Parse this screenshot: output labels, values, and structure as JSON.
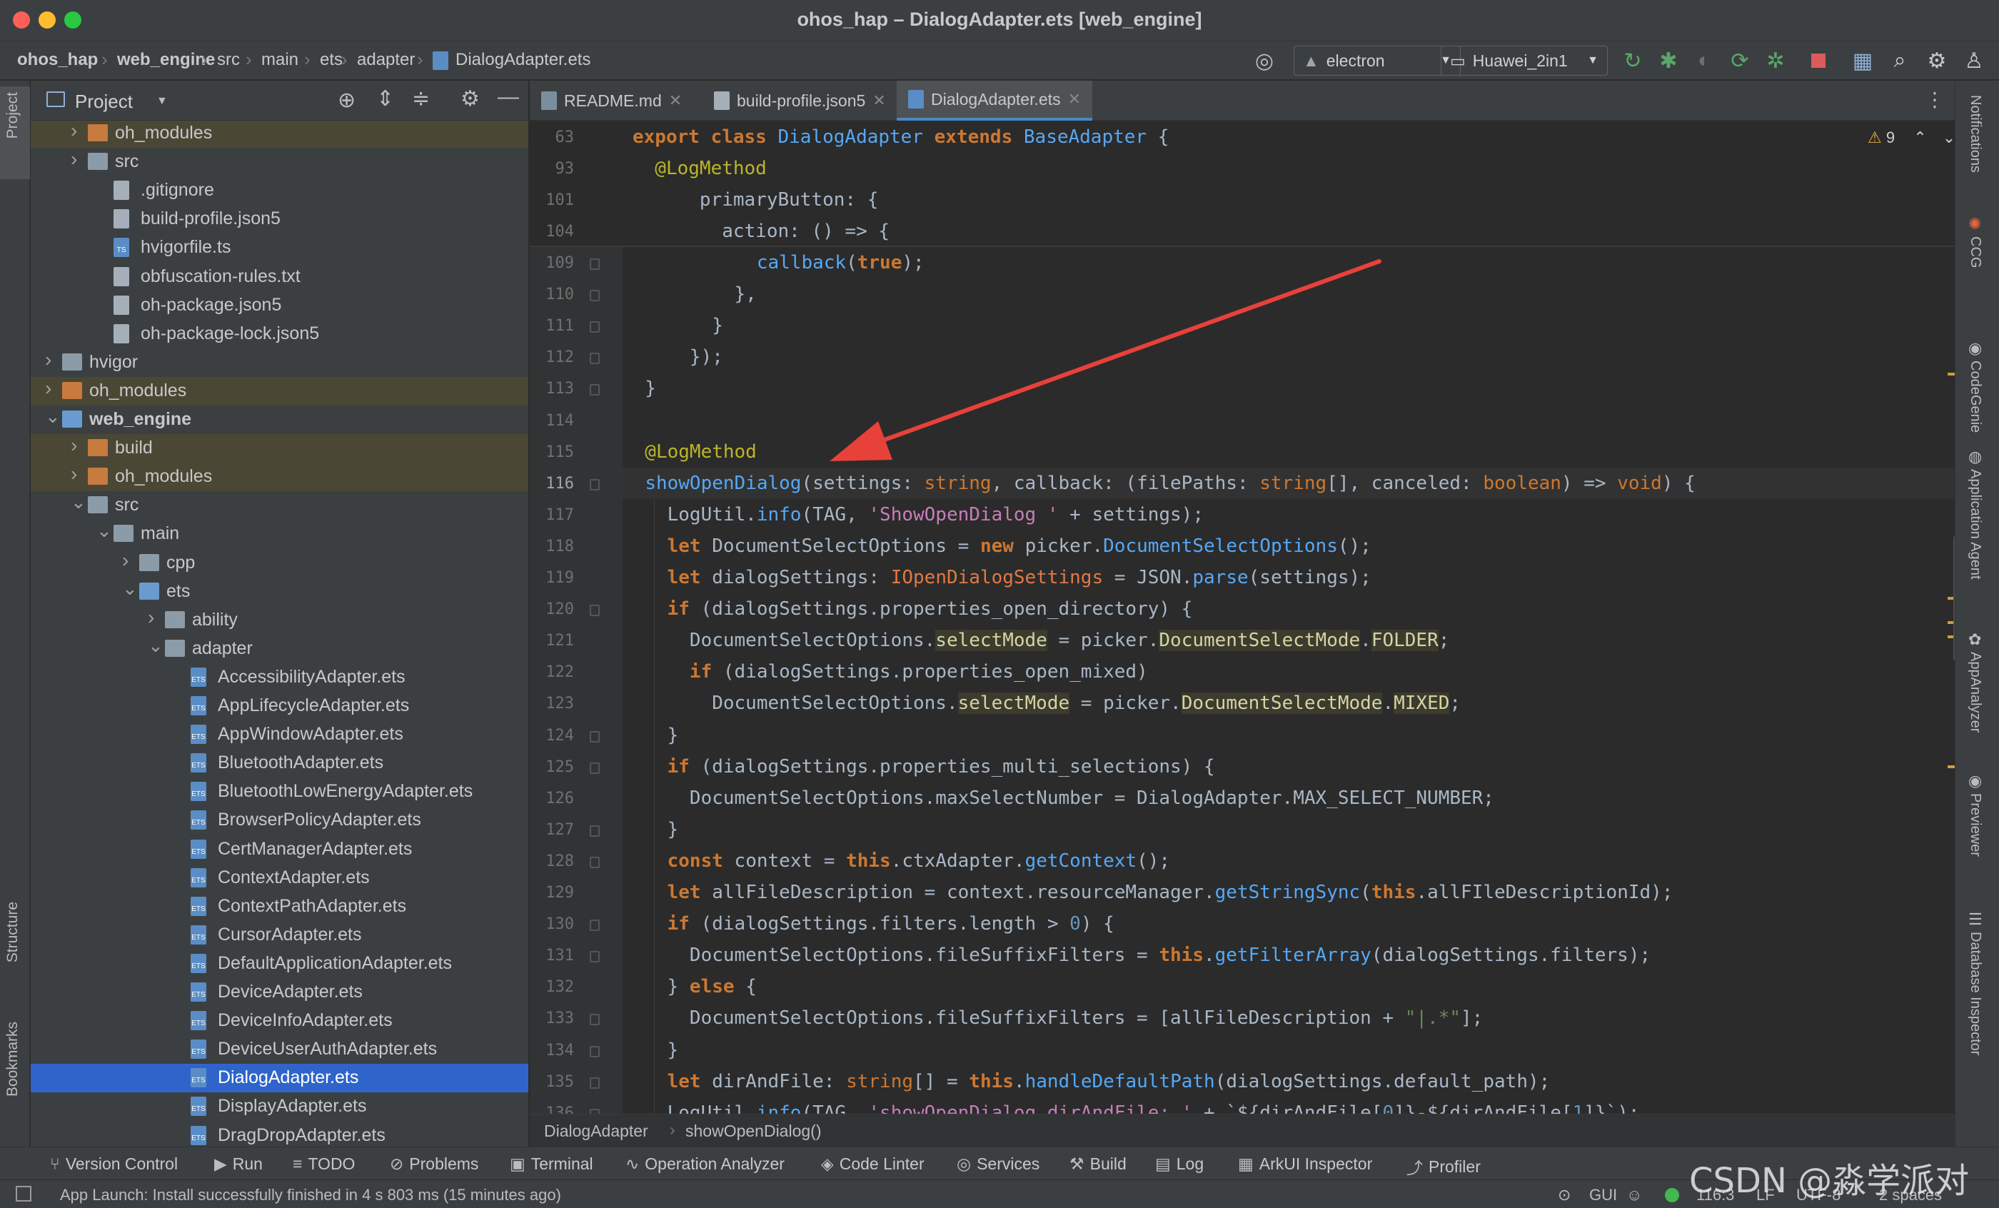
{
  "window": {
    "title": "ohos_hap – DialogAdapter.ets [web_engine]"
  },
  "breadcrumb": [
    "ohos_hap",
    "web_engine",
    "src",
    "main",
    "ets",
    "adapter",
    "DialogAdapter.ets"
  ],
  "toolbar": {
    "config_label": "electron",
    "device_label": "Huawei_2in1"
  },
  "project_panel": {
    "title": "Project"
  },
  "left_tabs": [
    "Project",
    "Structure",
    "Bookmarks"
  ],
  "tree": [
    {
      "label": "oh_modules",
      "depth": 2,
      "icon": "folder-orange",
      "arrow": "right",
      "hl": true
    },
    {
      "label": "src",
      "depth": 2,
      "icon": "folder",
      "arrow": "right"
    },
    {
      "label": ".gitignore",
      "depth": 3,
      "icon": "file"
    },
    {
      "label": "build-profile.json5",
      "depth": 3,
      "icon": "file"
    },
    {
      "label": "hvigorfile.ts",
      "depth": 3,
      "icon": "ts-file"
    },
    {
      "label": "obfuscation-rules.txt",
      "depth": 3,
      "icon": "file"
    },
    {
      "label": "oh-package.json5",
      "depth": 3,
      "icon": "file"
    },
    {
      "label": "oh-package-lock.json5",
      "depth": 3,
      "icon": "file"
    },
    {
      "label": "hvigor",
      "depth": 1,
      "icon": "folder",
      "arrow": "right"
    },
    {
      "label": "oh_modules",
      "depth": 1,
      "icon": "folder-orange",
      "arrow": "right",
      "hl": true
    },
    {
      "label": "web_engine",
      "depth": 1,
      "icon": "folder-blue",
      "arrow": "down",
      "bold": true
    },
    {
      "label": "build",
      "depth": 2,
      "icon": "folder-orange",
      "arrow": "right",
      "hl": true
    },
    {
      "label": "oh_modules",
      "depth": 2,
      "icon": "folder-orange",
      "arrow": "right",
      "hl": true
    },
    {
      "label": "src",
      "depth": 2,
      "icon": "folder",
      "arrow": "down"
    },
    {
      "label": "main",
      "depth": 3,
      "icon": "folder",
      "arrow": "down"
    },
    {
      "label": "cpp",
      "depth": 4,
      "icon": "folder",
      "arrow": "right"
    },
    {
      "label": "ets",
      "depth": 4,
      "icon": "folder-blue",
      "arrow": "down"
    },
    {
      "label": "ability",
      "depth": 5,
      "icon": "folder",
      "arrow": "right"
    },
    {
      "label": "adapter",
      "depth": 5,
      "icon": "folder",
      "arrow": "down"
    },
    {
      "label": "AccessibilityAdapter.ets",
      "depth": 6,
      "icon": "ets-file"
    },
    {
      "label": "AppLifecycleAdapter.ets",
      "depth": 6,
      "icon": "ets-file"
    },
    {
      "label": "AppWindowAdapter.ets",
      "depth": 6,
      "icon": "ets-file"
    },
    {
      "label": "BluetoothAdapter.ets",
      "depth": 6,
      "icon": "ets-file"
    },
    {
      "label": "BluetoothLowEnergyAdapter.ets",
      "depth": 6,
      "icon": "ets-file"
    },
    {
      "label": "BrowserPolicyAdapter.ets",
      "depth": 6,
      "icon": "ets-file"
    },
    {
      "label": "CertManagerAdapter.ets",
      "depth": 6,
      "icon": "ets-file"
    },
    {
      "label": "ContextAdapter.ets",
      "depth": 6,
      "icon": "ets-file"
    },
    {
      "label": "ContextPathAdapter.ets",
      "depth": 6,
      "icon": "ets-file"
    },
    {
      "label": "CursorAdapter.ets",
      "depth": 6,
      "icon": "ets-file"
    },
    {
      "label": "DefaultApplicationAdapter.ets",
      "depth": 6,
      "icon": "ets-file"
    },
    {
      "label": "DeviceAdapter.ets",
      "depth": 6,
      "icon": "ets-file"
    },
    {
      "label": "DeviceInfoAdapter.ets",
      "depth": 6,
      "icon": "ets-file"
    },
    {
      "label": "DeviceUserAuthAdapter.ets",
      "depth": 6,
      "icon": "ets-file"
    },
    {
      "label": "DialogAdapter.ets",
      "depth": 6,
      "icon": "ets-file",
      "selected": true
    },
    {
      "label": "DisplayAdapter.ets",
      "depth": 6,
      "icon": "ets-file"
    },
    {
      "label": "DragDropAdapter.ets",
      "depth": 6,
      "icon": "ets-file"
    }
  ],
  "tabs": [
    {
      "label": "README.md",
      "active": false
    },
    {
      "label": "build-profile.json5",
      "active": false
    },
    {
      "label": "DialogAdapter.ets",
      "active": true
    }
  ],
  "warnings": {
    "count": "9"
  },
  "sticky_lines": [
    {
      "num": "63",
      "parts": [
        [
          "k",
          "export class "
        ],
        [
          "cls",
          "DialogAdapter "
        ],
        [
          "k",
          "extends "
        ],
        [
          "cls",
          "BaseAdapter "
        ],
        [
          "",
          "{"
        ]
      ]
    },
    {
      "num": "93",
      "parts": [
        [
          "a",
          "  @LogMethod"
        ]
      ]
    },
    {
      "num": "101",
      "parts": [
        [
          "",
          "      primaryButton: {"
        ]
      ]
    },
    {
      "num": "104",
      "parts": [
        [
          "",
          "        action: () => {"
        ]
      ]
    }
  ],
  "code_lines": [
    {
      "num": "109",
      "parts": [
        [
          "",
          "            "
        ],
        [
          "f",
          "callback"
        ],
        [
          "",
          "("
        ],
        [
          "k",
          "true"
        ],
        [
          "",
          ");"
        ]
      ]
    },
    {
      "num": "110",
      "parts": [
        [
          "",
          "          },"
        ]
      ]
    },
    {
      "num": "111",
      "parts": [
        [
          "",
          "        }"
        ]
      ]
    },
    {
      "num": "112",
      "parts": [
        [
          "",
          "      });"
        ]
      ]
    },
    {
      "num": "113",
      "parts": [
        [
          "",
          "  }"
        ]
      ]
    },
    {
      "num": "114",
      "parts": [
        [
          "",
          ""
        ]
      ]
    },
    {
      "num": "115",
      "parts": [
        [
          "a",
          "  @LogMethod"
        ]
      ]
    },
    {
      "num": "116",
      "cur": true,
      "parts": [
        [
          "",
          "  "
        ],
        [
          "f",
          "showOpenDialog"
        ],
        [
          "",
          "(settings: "
        ],
        [
          "kt",
          "string"
        ],
        [
          "",
          ", callback: (filePaths: "
        ],
        [
          "kt",
          "string"
        ],
        [
          "",
          "[], canceled: "
        ],
        [
          "kt",
          "boolean"
        ],
        [
          "",
          ") => "
        ],
        [
          "kt",
          "void"
        ],
        [
          "",
          ") {"
        ]
      ]
    },
    {
      "num": "117",
      "parts": [
        [
          "",
          "    LogUtil."
        ],
        [
          "f",
          "info"
        ],
        [
          "",
          "(TAG, "
        ],
        [
          "s2",
          "'ShowOpenDialog '"
        ],
        [
          "",
          " + settings);"
        ]
      ]
    },
    {
      "num": "118",
      "parts": [
        [
          "",
          "    "
        ],
        [
          "k",
          "let "
        ],
        [
          "",
          "DocumentSelectOptions = "
        ],
        [
          "k",
          "new "
        ],
        [
          "",
          "picker."
        ],
        [
          "f",
          "DocumentSelectOptions"
        ],
        [
          "",
          "();"
        ]
      ]
    },
    {
      "num": "119",
      "parts": [
        [
          "",
          "    "
        ],
        [
          "k",
          "let "
        ],
        [
          "",
          "dialogSettings: "
        ],
        [
          "t",
          "IOpenDialogSettings"
        ],
        [
          "",
          " = JSON."
        ],
        [
          "f",
          "parse"
        ],
        [
          "",
          "(settings);"
        ]
      ]
    },
    {
      "num": "120",
      "parts": [
        [
          "",
          "    "
        ],
        [
          "k",
          "if "
        ],
        [
          "",
          "(dialogSettings.properties_open_directory) {"
        ]
      ]
    },
    {
      "num": "121",
      "parts": [
        [
          "",
          "      DocumentSelectOptions."
        ],
        [
          "hlw",
          "selectMode"
        ],
        [
          "",
          " = picker."
        ],
        [
          "hlw",
          "DocumentSelectMode"
        ],
        [
          "",
          "."
        ],
        [
          "hlw",
          "FOLDER"
        ],
        [
          "",
          ";"
        ]
      ]
    },
    {
      "num": "122",
      "parts": [
        [
          "",
          "      "
        ],
        [
          "k",
          "if "
        ],
        [
          "",
          "(dialogSettings.properties_open_mixed)"
        ]
      ]
    },
    {
      "num": "123",
      "parts": [
        [
          "",
          "        DocumentSelectOptions."
        ],
        [
          "hlw",
          "selectMode"
        ],
        [
          "",
          " = picker."
        ],
        [
          "hlw",
          "DocumentSelectMode"
        ],
        [
          "",
          "."
        ],
        [
          "hlw",
          "MIXED"
        ],
        [
          "",
          ";"
        ]
      ]
    },
    {
      "num": "124",
      "parts": [
        [
          "",
          "    }"
        ]
      ]
    },
    {
      "num": "125",
      "parts": [
        [
          "",
          "    "
        ],
        [
          "k",
          "if "
        ],
        [
          "",
          "(dialogSettings.properties_multi_selections) {"
        ]
      ]
    },
    {
      "num": "126",
      "parts": [
        [
          "",
          "      DocumentSelectOptions.maxSelectNumber = DialogAdapter.MAX_SELECT_NUMBER;"
        ]
      ]
    },
    {
      "num": "127",
      "parts": [
        [
          "",
          "    }"
        ]
      ]
    },
    {
      "num": "128",
      "parts": [
        [
          "",
          "    "
        ],
        [
          "k",
          "const "
        ],
        [
          "",
          "context = "
        ],
        [
          "k",
          "this"
        ],
        [
          "",
          ".ctxAdapter."
        ],
        [
          "f",
          "getContext"
        ],
        [
          "",
          "();"
        ]
      ]
    },
    {
      "num": "129",
      "parts": [
        [
          "",
          "    "
        ],
        [
          "k",
          "let "
        ],
        [
          "",
          "allFileDescription = context.resourceManager."
        ],
        [
          "f",
          "getStringSync"
        ],
        [
          "",
          "("
        ],
        [
          "k",
          "this"
        ],
        [
          "",
          ".allFIleDescriptionId);"
        ]
      ]
    },
    {
      "num": "130",
      "parts": [
        [
          "",
          "    "
        ],
        [
          "k",
          "if "
        ],
        [
          "",
          "(dialogSettings.filters.length > "
        ],
        [
          "n",
          "0"
        ],
        [
          "",
          ") {"
        ]
      ]
    },
    {
      "num": "131",
      "parts": [
        [
          "",
          "      DocumentSelectOptions.fileSuffixFilters = "
        ],
        [
          "k",
          "this"
        ],
        [
          "",
          "."
        ],
        [
          "f",
          "getFilterArray"
        ],
        [
          "",
          "(dialogSettings.filters);"
        ]
      ]
    },
    {
      "num": "132",
      "parts": [
        [
          "",
          "    } "
        ],
        [
          "k",
          "else "
        ],
        [
          "",
          "{"
        ]
      ]
    },
    {
      "num": "133",
      "parts": [
        [
          "",
          "      DocumentSelectOptions.fileSuffixFilters = [allFileDescription + "
        ],
        [
          "s",
          "\"|.*\""
        ],
        [
          "",
          "];"
        ]
      ]
    },
    {
      "num": "134",
      "parts": [
        [
          "",
          "    }"
        ]
      ]
    },
    {
      "num": "135",
      "parts": [
        [
          "",
          "    "
        ],
        [
          "k",
          "let "
        ],
        [
          "",
          "dirAndFile: "
        ],
        [
          "kt",
          "string"
        ],
        [
          "",
          "[] = "
        ],
        [
          "k",
          "this"
        ],
        [
          "",
          "."
        ],
        [
          "f",
          "handleDefaultPath"
        ],
        [
          "",
          "(dialogSettings.default_path);"
        ]
      ]
    },
    {
      "num": "136",
      "parts": [
        [
          "",
          "    LogUtil."
        ],
        [
          "f",
          "info"
        ],
        [
          "",
          "(TAG, "
        ],
        [
          "s2",
          "'showOpenDialog dirAndFile: '"
        ],
        [
          "",
          " + `${dirAndFile["
        ],
        [
          "n",
          "0"
        ],
        [
          "",
          "]}-${dirAndFile["
        ],
        [
          "n",
          "1"
        ],
        [
          "",
          "]}`);"
        ]
      ]
    }
  ],
  "editor_breadcrumb": [
    "DialogAdapter",
    "showOpenDialog()"
  ],
  "right_tabs": [
    "Notifications",
    "CCG",
    "CodeGenie",
    "Application Agent",
    "AppAnalyzer",
    "Previewer",
    "Database Inspector"
  ],
  "tool_windows": [
    "Version Control",
    "Run",
    "TODO",
    "Problems",
    "Terminal",
    "Operation Analyzer",
    "Code Linter",
    "Services",
    "Build",
    "Log",
    "ArkUI Inspector",
    "Profiler"
  ],
  "status": {
    "message": "App Launch: Install successfully finished in 4 s 803 ms (15 minutes ago)",
    "gui": "GUI",
    "position": "116:3",
    "line_sep": "LF",
    "encoding": "UTF-8",
    "indent": "2 spaces"
  },
  "watermark": "CSDN @淼学派对",
  "colors": {
    "accent": "#2f65ca",
    "annotation_arrow": "#e8413a"
  }
}
